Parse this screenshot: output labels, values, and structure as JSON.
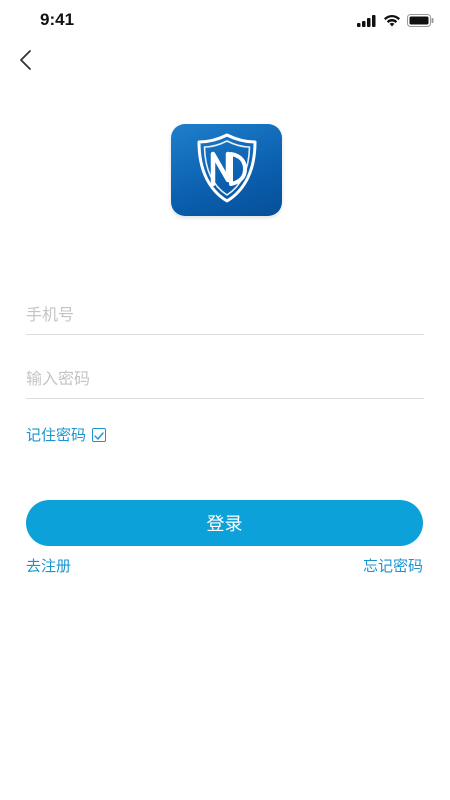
{
  "status_bar": {
    "time": "9:41",
    "icons": [
      "signal-icon",
      "wifi-icon",
      "battery-icon"
    ]
  },
  "nav": {
    "back_icon": "chevron-left-icon"
  },
  "logo": {
    "icon": "shield-logo-icon",
    "colors": {
      "background": "#0a5fae",
      "stroke": "#ffffff"
    }
  },
  "form": {
    "phone_placeholder": "手机号",
    "password_placeholder": "输入密码",
    "remember_label": "记住密码",
    "remember_checked": true,
    "login_label": "登录",
    "register_label": "去注册",
    "forgot_label": "忘记密码"
  },
  "colors": {
    "accent": "#0ca1d8",
    "link": "#1a94cf",
    "divider": "#dcdcdc",
    "placeholder": "#c4c4c4"
  }
}
